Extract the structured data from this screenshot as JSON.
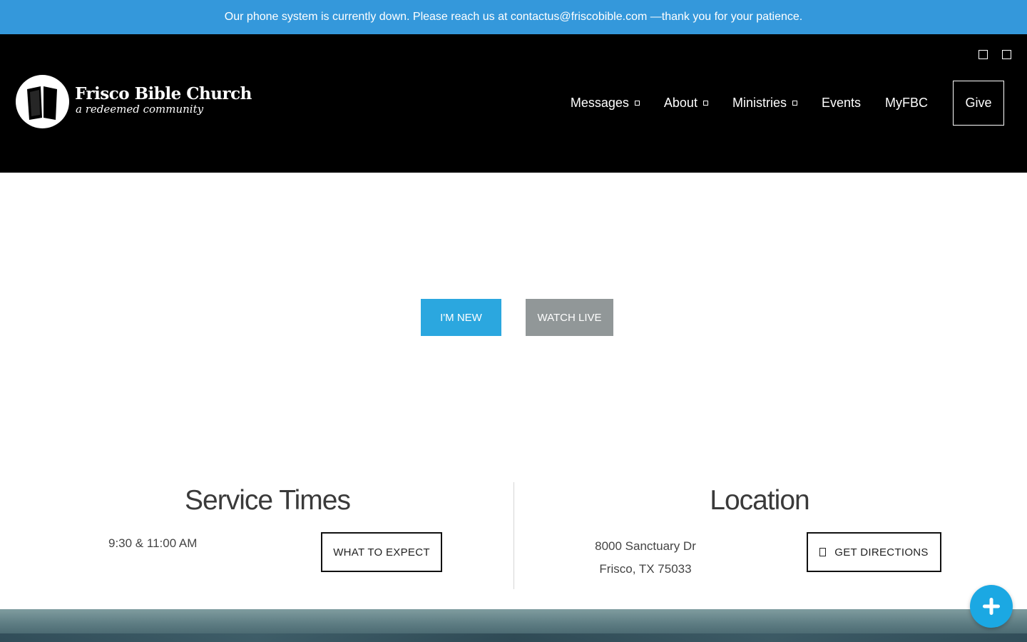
{
  "announcement": {
    "text": "Our phone system is currently down. Please reach us at contactus@friscobible.com —thank you for your patience."
  },
  "brand": {
    "name": "Frisco Bible Church",
    "tagline": "a redeemed community"
  },
  "nav": {
    "items": [
      {
        "label": "Messages",
        "has_dropdown": true
      },
      {
        "label": "About",
        "has_dropdown": true
      },
      {
        "label": "Ministries",
        "has_dropdown": true
      },
      {
        "label": "Events",
        "has_dropdown": false
      },
      {
        "label": "MyFBC",
        "has_dropdown": false
      }
    ],
    "give_label": "Give"
  },
  "hero": {
    "new_label": "I'M NEW",
    "live_label": "WATCH LIVE"
  },
  "service": {
    "heading": "Service Times",
    "times": "9:30 & 11:00 AM",
    "button_label": "WHAT TO EXPECT"
  },
  "location": {
    "heading": "Location",
    "address_line1": "8000 Sanctuary Dr",
    "address_line2": "Frisco, TX 75033",
    "button_label": "GET DIRECTIONS"
  },
  "colors": {
    "announcement_bg": "#3498db",
    "header_bg": "#000000",
    "primary_button": "#2ba7df",
    "secondary_button": "#919798",
    "fab": "#1ba8e3"
  },
  "icons": {
    "social_1": "square-social-icon",
    "social_2": "square-social-icon",
    "directions": "map-pin-icon",
    "fab": "plus-icon"
  }
}
